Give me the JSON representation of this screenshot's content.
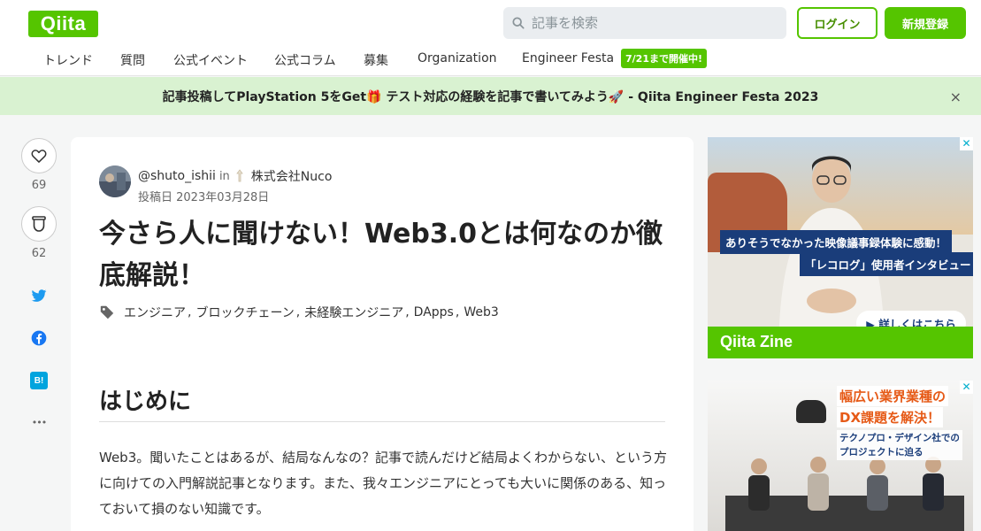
{
  "header": {
    "logo": "Qiita",
    "search_placeholder": "記事を検索",
    "login": "ログイン",
    "signup": "新規登録"
  },
  "nav": {
    "items": [
      "トレンド",
      "質問",
      "公式イベント",
      "公式コラム",
      "募集",
      "Organization",
      "Engineer Festa"
    ],
    "badge": "7/21まで開催中!"
  },
  "banner": {
    "text": "記事投稿してPlayStation 5をGet🎁 テスト対応の経験を記事で書いてみよう🚀 - Qiita Engineer Festa 2023",
    "close": "×"
  },
  "actions": {
    "likes": "69",
    "stocks": "62",
    "hatena_label": "B!",
    "more": "•••"
  },
  "article": {
    "author": "@shuto_ishii",
    "in": "in",
    "org": "株式会社Nuco",
    "date": "投稿日 2023年03月28日",
    "title": "今さら人に聞けない！Web3.0とは何なのか徹底解説！",
    "tags": [
      "エンジニア",
      "ブロックチェーン",
      "未経験エンジニア",
      "DApps",
      "Web3"
    ],
    "heading": "はじめに",
    "body": "Web3。聞いたことはあるが、結局なんなの？記事で読んだけど結局よくわからない、という方に向けての入門解説記事となります。また、我々エンジニアにとっても大いに関係のある、知っておいて損のない知識です。"
  },
  "ads": {
    "ad1": {
      "caption1": "ありそうでなかった映像議事録体験に感動！",
      "caption2": "「レコログ」使用者インタビュー",
      "cta": "▶ 詳しくはこちら",
      "brand": "Qiita Zine"
    },
    "ad2": {
      "headline1": "幅広い業界業種の",
      "headline2": "DX課題を解決！",
      "sub1": "テクノプロ・デザイン社での",
      "sub2": "プロジェクトに迫る"
    },
    "close": "✕"
  },
  "colors": {
    "brand": "#55c500",
    "banner_bg": "#d9f2d1",
    "ad_navy": "#1a3d7a",
    "ad_orange": "#e65a17"
  }
}
